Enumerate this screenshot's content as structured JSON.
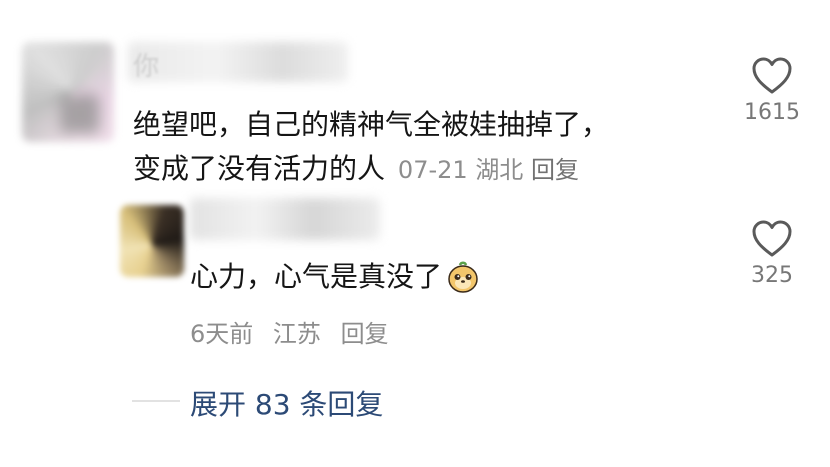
{
  "comment": {
    "text_line1": "绝望吧，自己的精神气全被娃抽掉了，",
    "text_line2": "变成了没有活力的人",
    "date": "07-21",
    "location": "湖北",
    "reply_label": "回复",
    "likes": "1615",
    "name_visible_char": "你"
  },
  "reply": {
    "text": "心力，心气是真没了",
    "emoji": "meerkat-emoji",
    "time": "6天前",
    "location": "江苏",
    "reply_label": "回复",
    "likes": "325"
  },
  "expand": {
    "label": "展开 83 条回复"
  },
  "colors": {
    "text": "#151515",
    "meta": "#8d8d8d",
    "link": "#2c4a76",
    "like_icon": "#5a5a5a"
  },
  "icons": [
    "heart-outline-icon",
    "meerkat-emoji"
  ]
}
